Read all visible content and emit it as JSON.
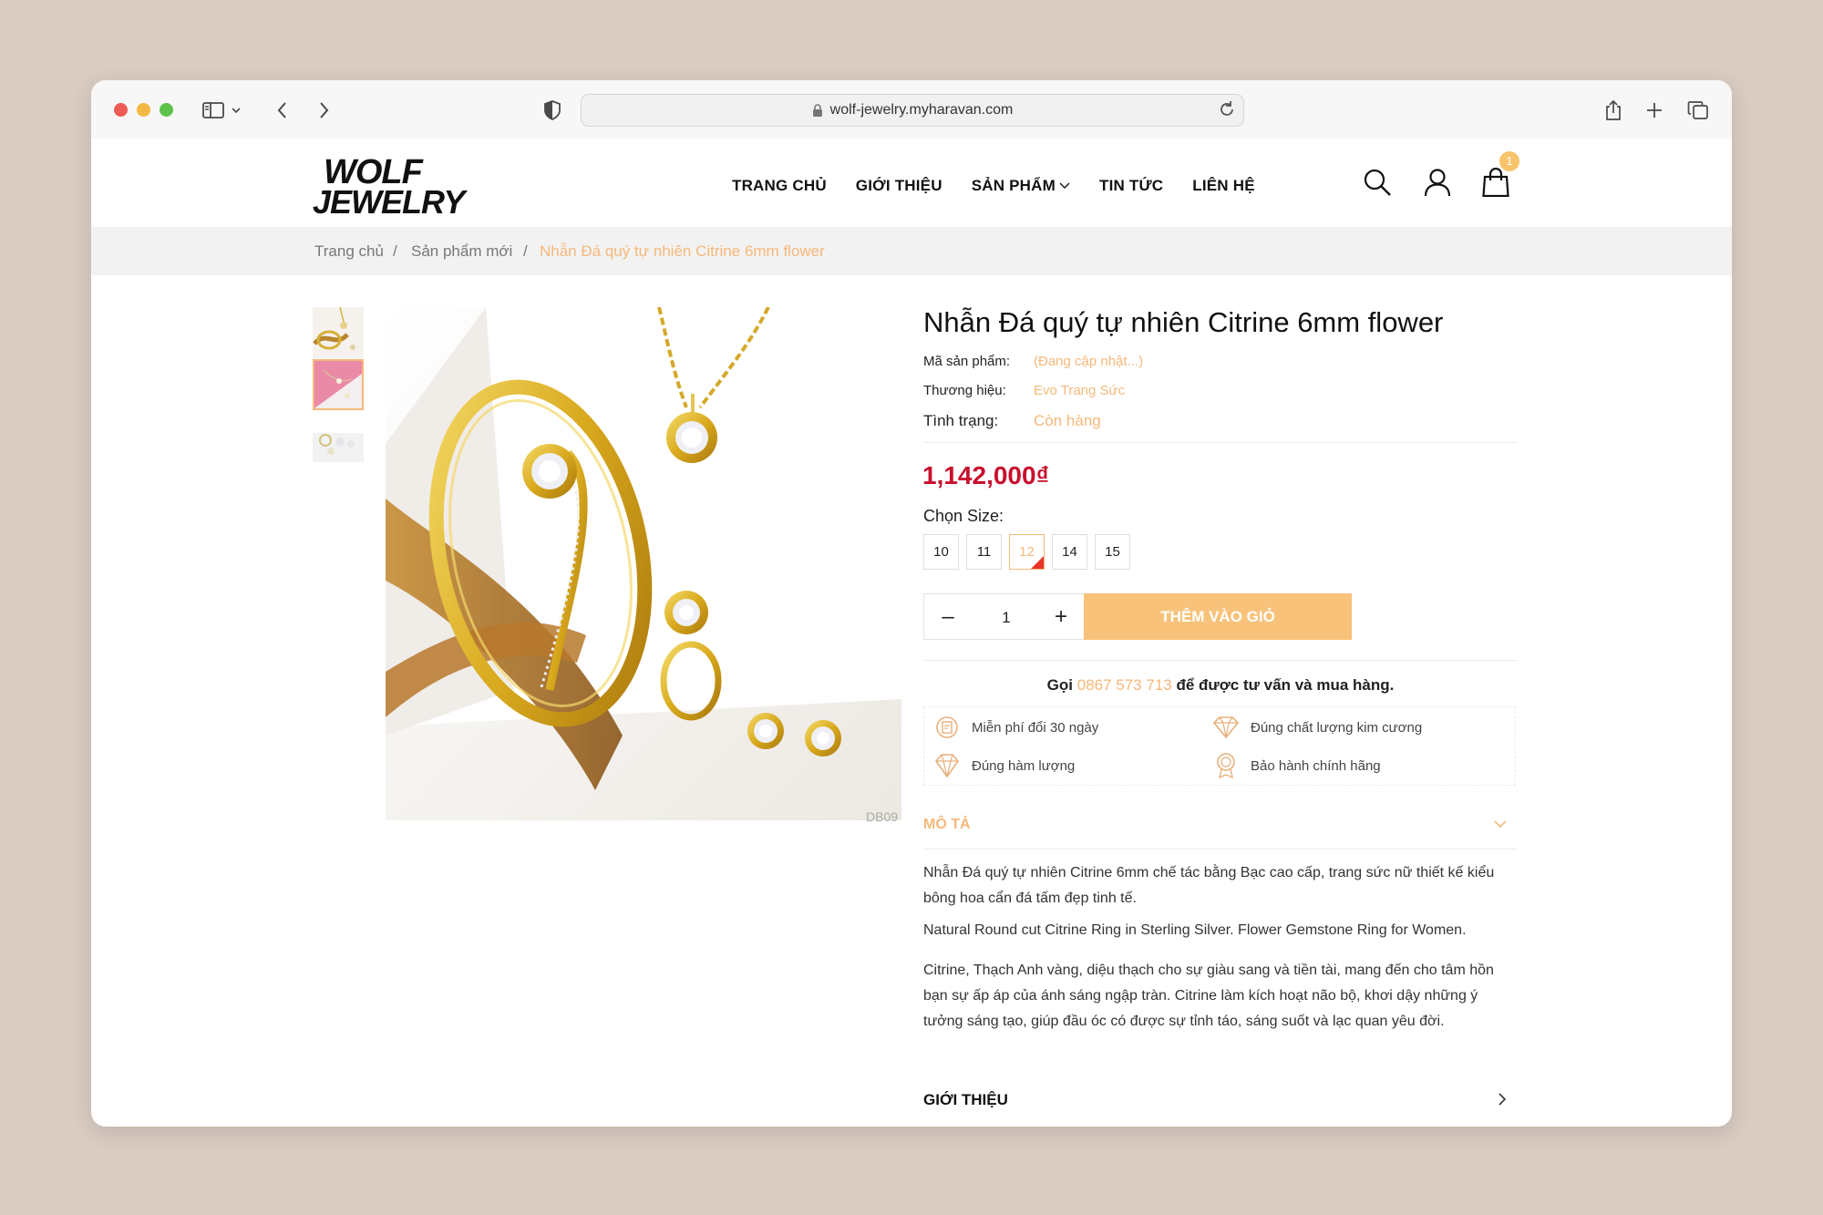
{
  "browser": {
    "url": "wolf-jewelry.myharavan.com"
  },
  "header": {
    "logo_text": "WOLF JEWELRY",
    "nav": [
      "TRANG CHỦ",
      "GIỚI THIỆU",
      "SẢN PHẨM",
      "TIN TỨC",
      "LIÊN HỆ"
    ],
    "cart_count": "1"
  },
  "breadcrumb": {
    "items": [
      "Trang chủ",
      "Sản phẩm mới",
      "Nhẫn Đá quý tự nhiên Citrine 6mm flower"
    ],
    "separator": "/"
  },
  "gallery": {
    "image_code": "DB09"
  },
  "product": {
    "title": "Nhẫn Đá quý tự nhiên Citrine 6mm flower",
    "meta": [
      {
        "label": "Mã sản phẩm:",
        "value": "(Đang cập nhật...)"
      },
      {
        "label": "Thương hiệu:",
        "value": "Evo Trang Sức"
      },
      {
        "label": "Tình trạng:",
        "value": "Còn hàng"
      }
    ],
    "price": "1,142,000₫",
    "size_label": "Chọn Size:",
    "sizes": [
      "10",
      "11",
      "12",
      "14",
      "15"
    ],
    "selected_size": "12",
    "quantity": "1",
    "minus": "–",
    "plus": "+",
    "add_to_cart": "THÊM VÀO GIỎ",
    "call_prefix": "Gọi",
    "phone": "0867 573 713",
    "call_suffix": "để được tư vấn và mua hàng."
  },
  "features": [
    {
      "text": "Miễn phí đổi 30 ngày",
      "icon": "exchange-icon"
    },
    {
      "text": "Đúng chất lượng kim cương",
      "icon": "diamond-icon"
    },
    {
      "text": "Đúng hàm lượng",
      "icon": "gem-icon"
    },
    {
      "text": "Bảo hành chính hãng",
      "icon": "warranty-icon"
    }
  ],
  "description": {
    "heading": "MÔ TẢ",
    "paragraphs": [
      "Nhẫn Đá quý tự nhiên Citrine 6mm chế tác bằng Bạc cao cấp, trang sức nữ thiết kế kiểu bông hoa cẩn đá tấm đẹp tinh tế.",
      "Natural Round cut Citrine Ring in Sterling Silver. Flower Gemstone Ring for Women.",
      "Citrine, Thạch Anh vàng, diệu thạch cho sự giàu sang và tiền tài, mang đến cho tâm hồn bạn sự ấp áp của ánh sáng ngập tràn. Citrine làm kích hoạt não bộ, khơi dậy những ý tưởng sáng tạo, giúp đầu óc có được sự tỉnh táo, sáng suốt và lạc quan yêu đời."
    ]
  },
  "about": {
    "heading": "GIỚI THIỆU"
  },
  "colors": {
    "accent": "#f6b87a",
    "button": "#f8c27a",
    "price": "#c8102e"
  }
}
